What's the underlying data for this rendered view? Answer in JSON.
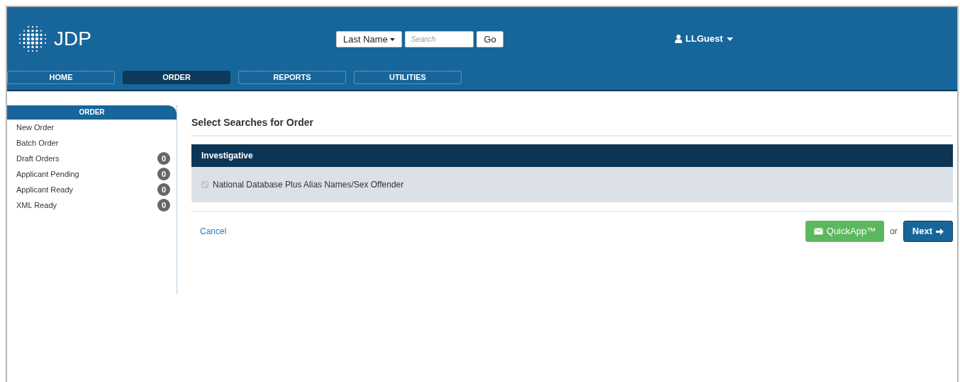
{
  "header": {
    "logo": "JDP",
    "search_type": "Last Name",
    "search": {
      "placeholder": "Search"
    },
    "go_button": "Go",
    "user": "LLGuest"
  },
  "tabs": [
    {
      "label": "HOME",
      "selected": false
    },
    {
      "label": "ORDER",
      "selected": true
    },
    {
      "label": "REPORTS",
      "selected": false
    },
    {
      "label": "UTILITIES",
      "selected": false
    }
  ],
  "sidebar": {
    "title": "ORDER",
    "items": [
      {
        "label": "New Order"
      },
      {
        "label": "Batch Order"
      },
      {
        "label": "Draft Orders",
        "count": "0"
      },
      {
        "label": "Applicant Pending",
        "count": "0"
      },
      {
        "label": "Applicant Ready",
        "count": "0"
      },
      {
        "label": "XML Ready",
        "count": "0"
      }
    ]
  },
  "main": {
    "title": "Select Searches for Order",
    "panel": {
      "title": "Investigative",
      "options": [
        {
          "label": "National Database Plus Alias Names/Sex Offender",
          "checked": true,
          "disabled": true
        }
      ]
    },
    "cancel": "Cancel",
    "quickapp_button": "QuickApp™",
    "or": "or",
    "next_button": "Next"
  }
}
